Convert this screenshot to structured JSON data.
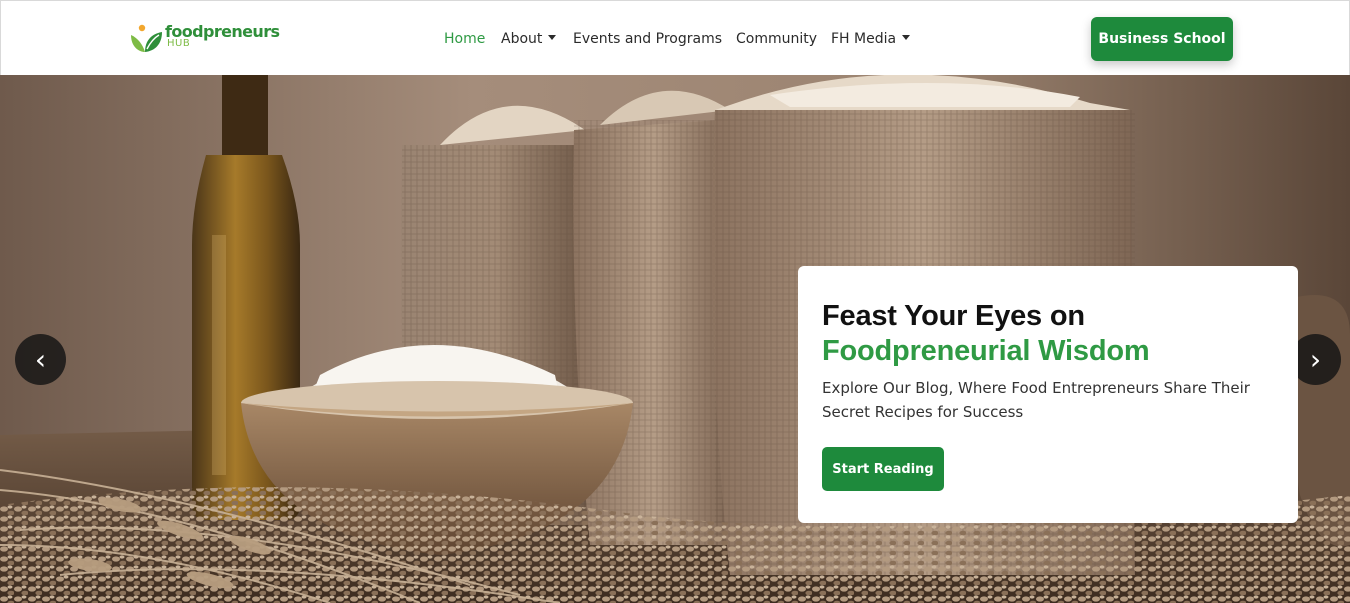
{
  "brand": {
    "name": "foodpreneurs",
    "sub": "HUB",
    "primary_color": "#1e8a3c",
    "accent_color": "#2f9a44",
    "logo_icon": "leaf-sprout-icon"
  },
  "nav": {
    "items": [
      {
        "label": "Home",
        "active": true,
        "dropdown": false
      },
      {
        "label": "About",
        "active": false,
        "dropdown": true
      },
      {
        "label": "Events and Programs",
        "active": false,
        "dropdown": false
      },
      {
        "label": "Community",
        "active": false,
        "dropdown": false
      },
      {
        "label": "FH Media",
        "active": false,
        "dropdown": true
      }
    ],
    "cta_label": "Business School"
  },
  "hero": {
    "title_line1": "Feast Your Eyes on",
    "title_line2": "Foodpreneurial Wisdom",
    "text": "Explore Our Blog, Where Food Entrepreneurs Share Their Secret Recipes for Success",
    "button_label": "Start Reading",
    "prev_glyph": "‹",
    "next_glyph": "›",
    "image_subject": "flour-and-wheat-photo"
  }
}
